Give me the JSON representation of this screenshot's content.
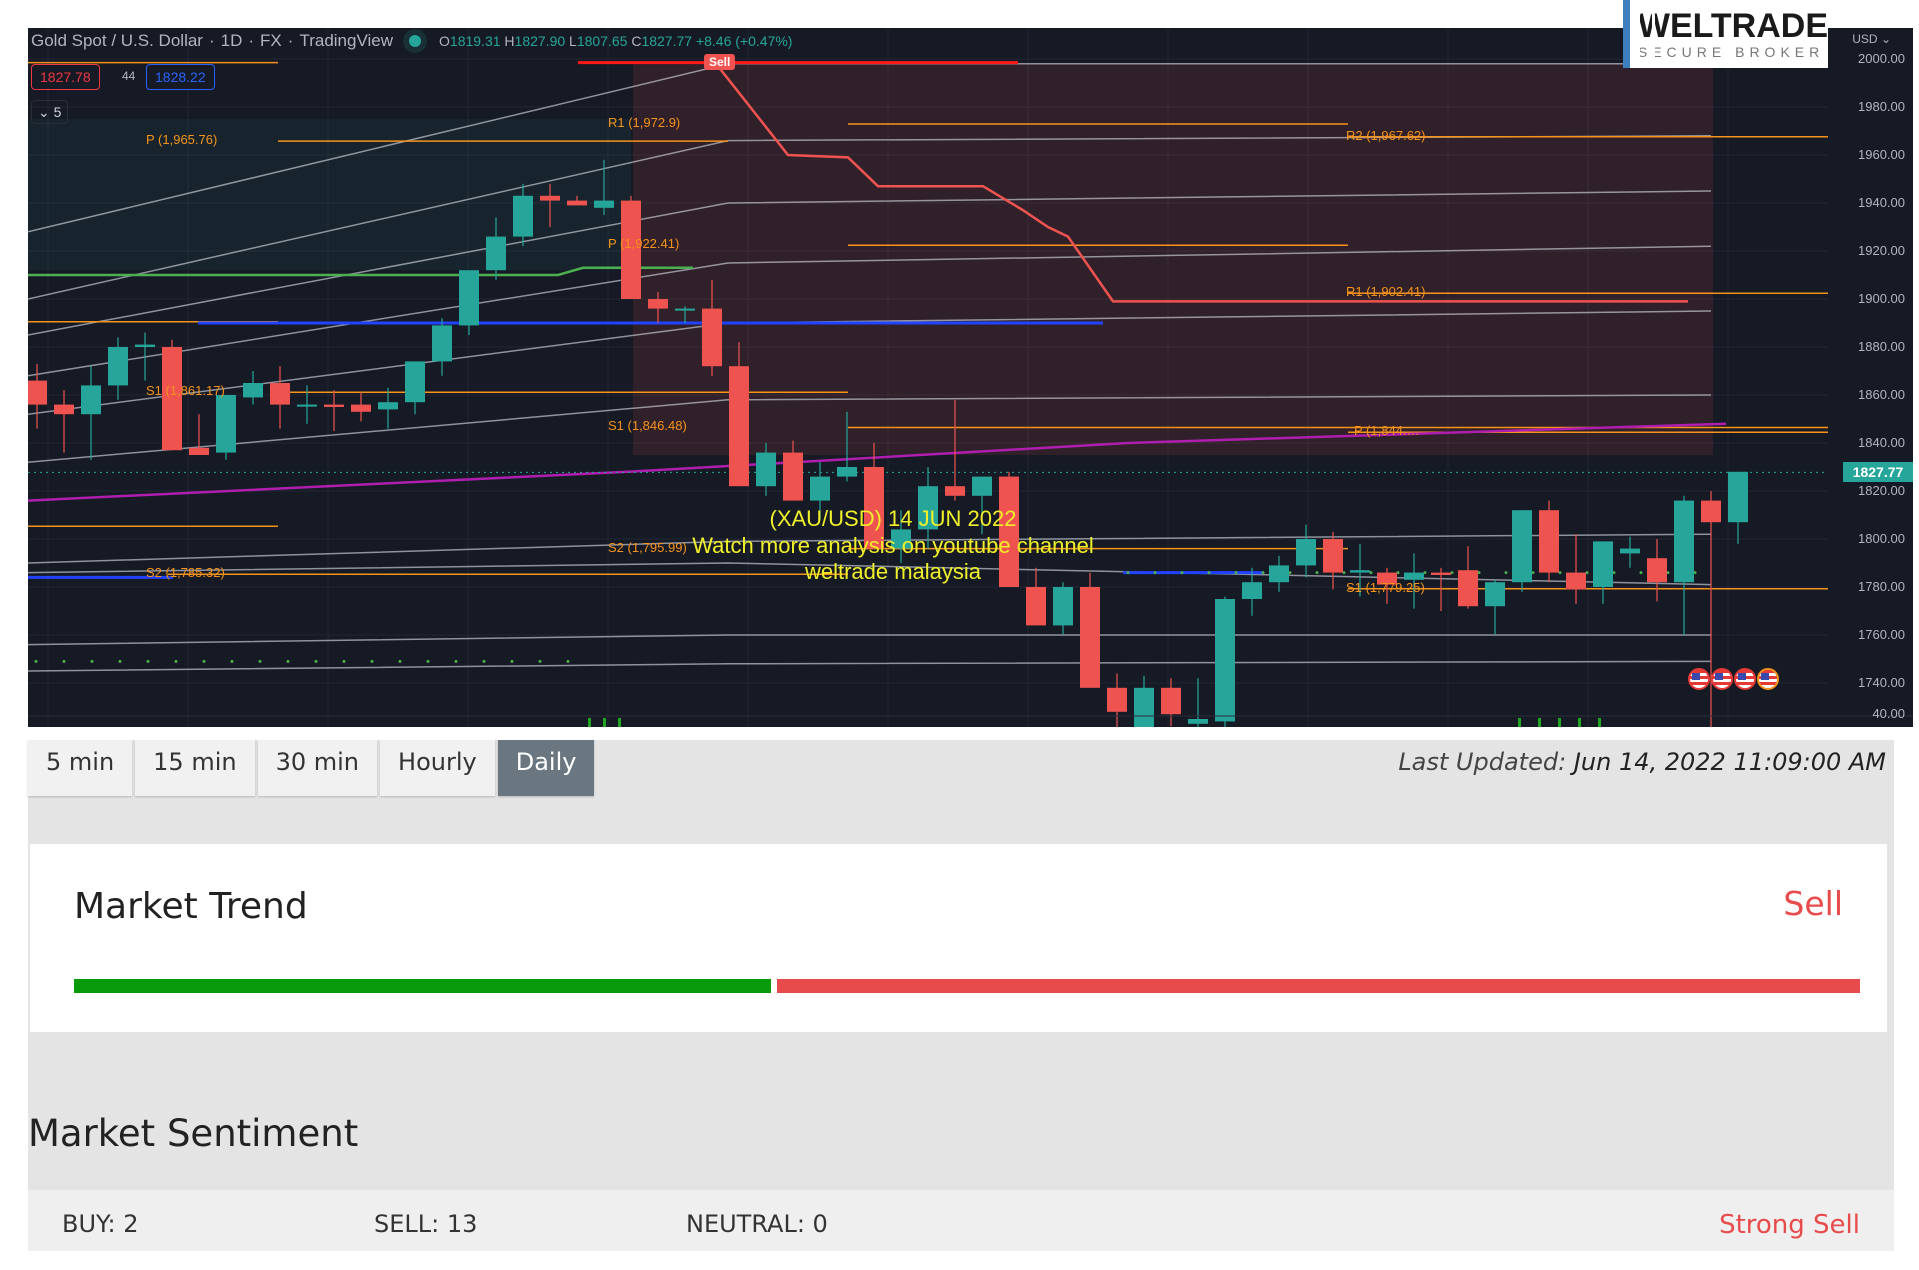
{
  "chart_header": {
    "symbol_title": "Gold Spot / U.S. Dollar",
    "interval": "1D",
    "exchange": "FX",
    "source": "TradingView",
    "open_label": "O",
    "open": "1819.31",
    "high_label": "H",
    "high": "1827.90",
    "low_label": "L",
    "low": "1807.65",
    "close_label": "C",
    "close": "1827.77",
    "change": "+8.46 (+0.47%)",
    "bid": "1827.78",
    "spread": "44",
    "ask": "1828.22",
    "indicators_collapse": "5",
    "currency": "USD"
  },
  "logo": {
    "name": "WELTRADE",
    "tagline": "SECURE BROKER"
  },
  "annotation": {
    "line1": "(XAU/USD) 14 JUN 2022",
    "line2": "Watch more analysis on youtube channel",
    "line3": "weltrade malaysia"
  },
  "sell_signal_label": "Sell",
  "chart_data": {
    "type": "candlestick",
    "title": "Gold Spot / U.S. Dollar · 1D · FX",
    "ylabel": "USD",
    "ylim": [
      1735,
      2005
    ],
    "yticks": [
      2000,
      1980,
      1960,
      1940,
      1920,
      1900,
      1880,
      1860,
      1840,
      1820,
      1800,
      1780,
      1760,
      1740
    ],
    "last_price": 1827.77,
    "volume_axis_label": "40.00",
    "candles": [
      [
        1866,
        1873,
        1846,
        1856
      ],
      [
        1856,
        1862,
        1836,
        1852
      ],
      [
        1852,
        1872,
        1833,
        1864
      ],
      [
        1864,
        1884,
        1858,
        1880
      ],
      [
        1880,
        1886,
        1866,
        1881
      ],
      [
        1880,
        1883,
        1837,
        1837
      ],
      [
        1838,
        1852,
        1835,
        1835
      ],
      [
        1836,
        1858,
        1833,
        1860
      ],
      [
        1859,
        1870,
        1856,
        1865
      ],
      [
        1865,
        1872,
        1846,
        1856
      ],
      [
        1856,
        1864,
        1848,
        1856
      ],
      [
        1856,
        1862,
        1845,
        1855
      ],
      [
        1856,
        1861,
        1849,
        1853
      ],
      [
        1854,
        1863,
        1846,
        1857
      ],
      [
        1857,
        1873,
        1852,
        1874
      ],
      [
        1874,
        1892,
        1868,
        1889
      ],
      [
        1889,
        1911,
        1885,
        1912
      ],
      [
        1912,
        1934,
        1908,
        1926
      ],
      [
        1926,
        1948,
        1922,
        1943
      ],
      [
        1943,
        1948,
        1930,
        1941
      ],
      [
        1941,
        1943,
        1940,
        1939
      ],
      [
        1938,
        1958,
        1935,
        1941
      ],
      [
        1941,
        1943,
        1900,
        1900
      ],
      [
        1900,
        1903,
        1890,
        1896
      ],
      [
        1896,
        1897,
        1890,
        1896
      ],
      [
        1896,
        1908,
        1868,
        1872
      ],
      [
        1872,
        1882,
        1822,
        1822
      ],
      [
        1822,
        1840,
        1818,
        1836
      ],
      [
        1836,
        1841,
        1817,
        1816
      ],
      [
        1816,
        1832,
        1808,
        1826
      ],
      [
        1826,
        1853,
        1824,
        1830
      ],
      [
        1830,
        1840,
        1812,
        1796
      ],
      [
        1796,
        1812,
        1790,
        1804
      ],
      [
        1804,
        1830,
        1796,
        1822
      ],
      [
        1822,
        1858,
        1816,
        1818
      ],
      [
        1818,
        1825,
        1802,
        1826
      ],
      [
        1826,
        1828,
        1792,
        1780
      ],
      [
        1780,
        1788,
        1771,
        1764
      ],
      [
        1764,
        1782,
        1760,
        1780
      ],
      [
        1780,
        1786,
        1756,
        1738
      ],
      [
        1738,
        1744,
        1710,
        1728
      ],
      [
        1716,
        1743,
        1698,
        1738
      ],
      [
        1738,
        1742,
        1722,
        1727
      ],
      [
        1723,
        1742,
        1716,
        1725
      ],
      [
        1724,
        1776,
        1720,
        1775
      ],
      [
        1775,
        1788,
        1768,
        1782
      ],
      [
        1782,
        1793,
        1778,
        1789
      ],
      [
        1789,
        1806,
        1784,
        1800
      ],
      [
        1800,
        1803,
        1779,
        1786
      ],
      [
        1786,
        1798,
        1776,
        1787
      ],
      [
        1786,
        1788,
        1773,
        1781
      ],
      [
        1783,
        1794,
        1771,
        1786
      ],
      [
        1786,
        1788,
        1770,
        1785
      ],
      [
        1787,
        1797,
        1771,
        1772
      ],
      [
        1772,
        1783,
        1760,
        1782
      ],
      [
        1782,
        1812,
        1778,
        1812
      ],
      [
        1812,
        1816,
        1782,
        1786
      ],
      [
        1786,
        1802,
        1773,
        1779
      ],
      [
        1780,
        1798,
        1773,
        1799
      ],
      [
        1794,
        1801,
        1788,
        1796
      ],
      [
        1792,
        1800,
        1774,
        1782
      ],
      [
        1782,
        1818,
        1760,
        1816
      ],
      [
        1816,
        1820,
        1703,
        1807
      ],
      [
        1807,
        1828,
        1798,
        1828
      ]
    ],
    "pivot_levels": [
      {
        "label": "P (1,965.76)",
        "value": 1965.76
      },
      {
        "label": "R1 (1,972.9)",
        "value": 1972.9
      },
      {
        "label": "R2 (1,967.62)",
        "value": 1967.62
      },
      {
        "label": "P (1,922.41)",
        "value": 1922.41
      },
      {
        "label": "R1 (1,902.41)",
        "value": 1902.41
      },
      {
        "label": "S1 (1,861.17)",
        "value": 1861.17
      },
      {
        "label": "S1 (1,846.48)",
        "value": 1846.48
      },
      {
        "label": "P (1,844.…",
        "value": 1844.5
      },
      {
        "label": "S2 (1,795.99)",
        "value": 1795.99
      },
      {
        "label": "S2 (1,785.32)",
        "value": 1785.32
      },
      {
        "label": "S1 (1,779.25)",
        "value": 1779.25
      }
    ],
    "series": [
      {
        "name": "supertrend-sell",
        "color": "#f05350",
        "values": [
          1997,
          1996,
          1995,
          1960,
          1959,
          1947,
          1947,
          1930,
          1926,
          1899,
          1899,
          1899
        ]
      },
      {
        "name": "moving-average",
        "color": "#b01eb0",
        "from": 1816,
        "to": 1848
      }
    ],
    "grid": true
  },
  "timeframe_tabs": [
    {
      "label": "5 min",
      "active": false
    },
    {
      "label": "15 min",
      "active": false
    },
    {
      "label": "30 min",
      "active": false
    },
    {
      "label": "Hourly",
      "active": false
    },
    {
      "label": "Daily",
      "active": true
    }
  ],
  "last_updated": {
    "label": "Last Updated:",
    "value": "Jun 14, 2022 11:09:00 AM"
  },
  "market_trend": {
    "title": "Market Trend",
    "signal": "Sell",
    "buy_share_pct": 39,
    "sell_share_pct": 61
  },
  "market_sentiment": {
    "title": "Market Sentiment",
    "buy": "BUY: 2",
    "sell": "SELL: 13",
    "neutral": "NEUTRAL: 0",
    "summary": "Strong Sell"
  },
  "colors": {
    "up": "#26a69a",
    "down": "#ef5350",
    "pivot": "#f7931a",
    "sell": "#e84b4b",
    "buy": "#0a9b0a"
  }
}
